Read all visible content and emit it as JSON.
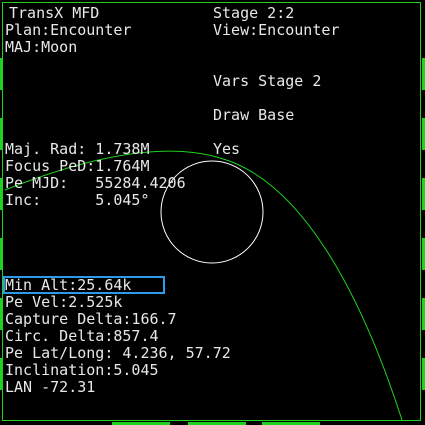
{
  "mfd": {
    "title": "TransX MFD",
    "plan": "Plan:Encounter",
    "major": "MAJ:Moon",
    "stage": "Stage 2:2",
    "view": "View:Encounter",
    "vars_stage": "Vars Stage 2",
    "draw_base": "Draw Base",
    "draw_base_value": "Yes"
  },
  "orbit_params": {
    "maj_rad": "Maj. Rad: 1.738M",
    "focus_ped": "Focus PeD:1.764M",
    "pe_mjd": "Pe MJD:   55284.4206",
    "inc": "Inc:      5.045°"
  },
  "encounter_params": {
    "min_alt": "Min Alt:25.64k",
    "pe_vel": "Pe Vel:2.525k",
    "capture_delta": "Capture Delta:166.7",
    "circ_delta": "Circ. Delta:857.4",
    "pe_lat_long": "Pe Lat/Long: 4.236, 57.72",
    "inclination": "Inclination:5.045",
    "lan": "LAN -72.31"
  },
  "colors": {
    "frame": "#1fd21f",
    "trajectory": "#1fd21f",
    "planet": "#ffffff",
    "text": "#e8e8e8",
    "selection": "#2a9be8"
  }
}
